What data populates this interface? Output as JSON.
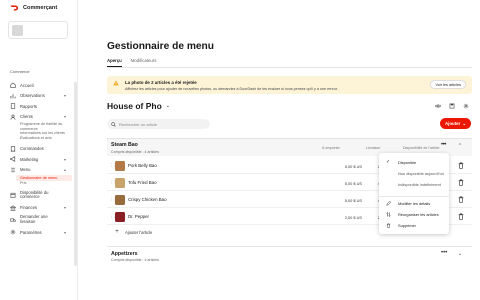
{
  "app": {
    "name": "Commerçant",
    "store_subtitle": "Commerce"
  },
  "sidebar": {
    "items": [
      {
        "label": "Accueil",
        "icon": "home-icon"
      },
      {
        "label": "Observations",
        "icon": "chart-icon",
        "chevron": "▾"
      },
      {
        "label": "Rapports",
        "icon": "report-icon"
      },
      {
        "label": "Clients",
        "icon": "user-icon",
        "chevron": "▾"
      },
      {
        "label": "Commandes",
        "icon": "receipt-icon"
      },
      {
        "label": "Marketing",
        "icon": "megaphone-icon",
        "chevron": "▾"
      },
      {
        "label": "Menu",
        "icon": "menu-icon",
        "chevron": "▴"
      },
      {
        "label": "Disponibilité du commerce",
        "icon": "calendar-icon"
      },
      {
        "label": "Finances",
        "icon": "bank-icon",
        "chevron": "▾"
      },
      {
        "label": "Demander une livraison",
        "icon": "truck-icon"
      },
      {
        "label": "Paramètres",
        "icon": "gear-icon",
        "chevron": "▾"
      }
    ],
    "clients_sub": [
      "Programme de fidélité du commerce",
      "Informations sur les clients",
      "Évaluations et avis"
    ],
    "menu_sub": [
      "Gestionnaire de menu",
      "Prix"
    ]
  },
  "main": {
    "title": "Gestionnaire de menu",
    "tabs": [
      "Aperçu",
      "Modificateurs"
    ],
    "banner": {
      "title": "La photo de 2 articles a été rejetée",
      "text": "Affichez les articles pour ajouter de nouvelles photos, ou demandez à DoorDash de les évaluer si vous pensez qu'il y a une erreur.",
      "button": "Voir les articles"
    },
    "menu_name": "House of Pho",
    "search": {
      "placeholder": "Rechercher un article"
    },
    "add_button": "Ajouter",
    "category": {
      "name": "Steam Bao",
      "availability": "Compris disponible : 4 articles",
      "columns": {
        "pickup": "À emporter",
        "delivery": "Livraison",
        "availability": "Disponibilité de l'article"
      },
      "items": [
        {
          "name": "Pork Belly Bao",
          "pickup": "5,00 $ US",
          "delivery": "2,99 $ US",
          "color": "#b47a45"
        },
        {
          "name": "Tofu Fried Bao",
          "pickup": "5,00 $ US",
          "delivery": "4,50 $ US",
          "color": "#c8a46a"
        },
        {
          "name": "Crispy Chicken Bao",
          "pickup": "5,00 $ US",
          "delivery": "4,50 $ US",
          "color": "#9b6a3a"
        },
        {
          "name": "Dr. Pepper",
          "pickup": "2,00 $ US",
          "delivery": "2,00 $ US",
          "color": "#8a1f24"
        }
      ],
      "add_item": "Ajouter l'article"
    },
    "category2": {
      "name": "Appetizers",
      "availability": "Compris disponible : 4 articles"
    },
    "dropdown": {
      "options": [
        "Disponible",
        "Non disponible aujourd'hui",
        "Indisponible indéfiniment"
      ],
      "actions": [
        "Modifier les détails",
        "Réorganiser les articles",
        "Supprimer"
      ]
    }
  }
}
